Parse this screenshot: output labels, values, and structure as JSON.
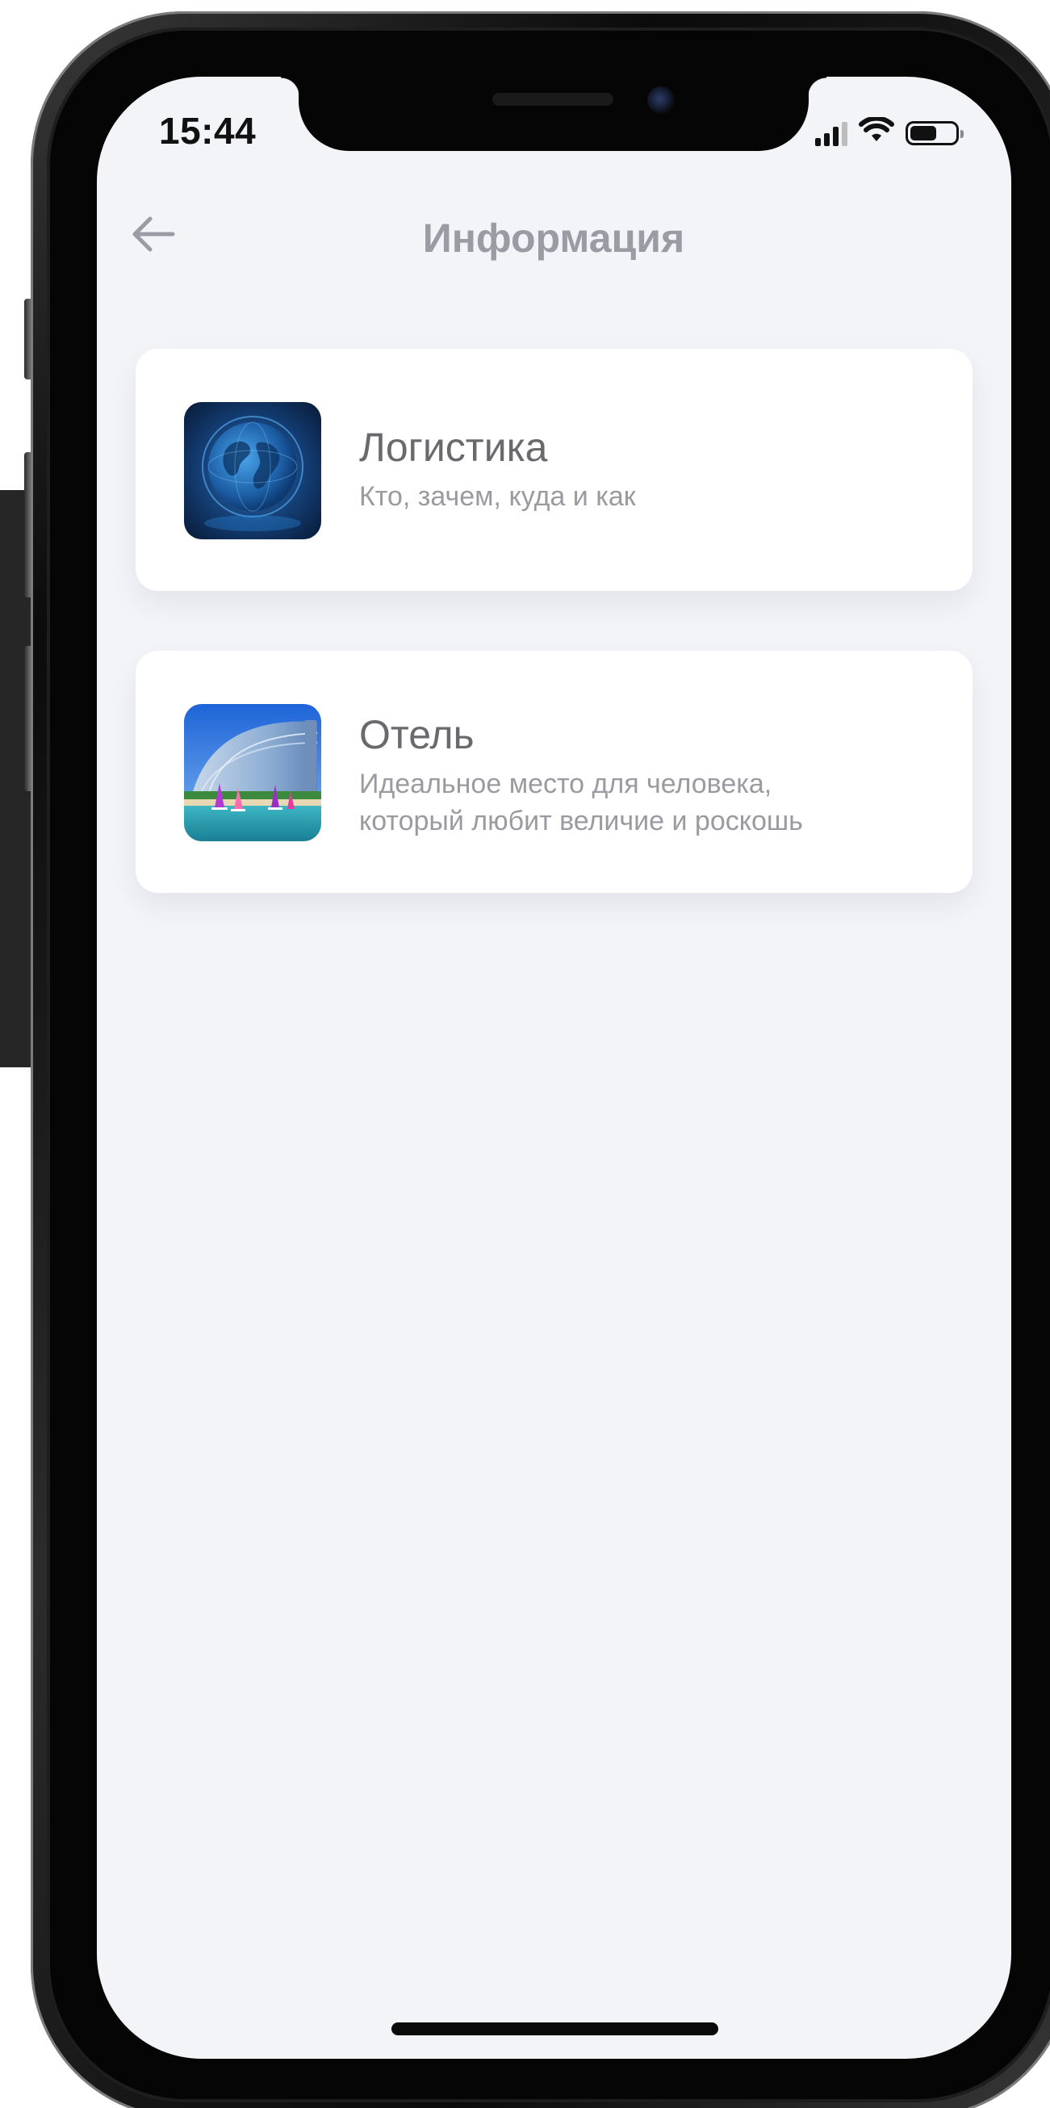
{
  "status_bar": {
    "time": "15:44",
    "signal_icon": "cellular-signal-icon",
    "wifi_icon": "wifi-icon",
    "battery_icon": "battery-icon",
    "battery_level": 0.6
  },
  "header": {
    "back_icon": "arrow-left-icon",
    "title": "Информация"
  },
  "cards": [
    {
      "title": "Логистика",
      "subtitle": "Кто, зачем, куда и как",
      "thumbnail": "globe-image"
    },
    {
      "title": "Отель",
      "subtitle_line1": "Идеальное место для человека,",
      "subtitle_line2": "который любит величие и роскошь",
      "thumbnail": "hotel-beach-image"
    }
  ],
  "colors": {
    "screen_background": "#f3f4f8",
    "card_background": "#ffffff",
    "title_color": "#9a9ba3",
    "card_title_color": "#6a6a6e",
    "card_subtitle_color": "#9a9ba1"
  }
}
